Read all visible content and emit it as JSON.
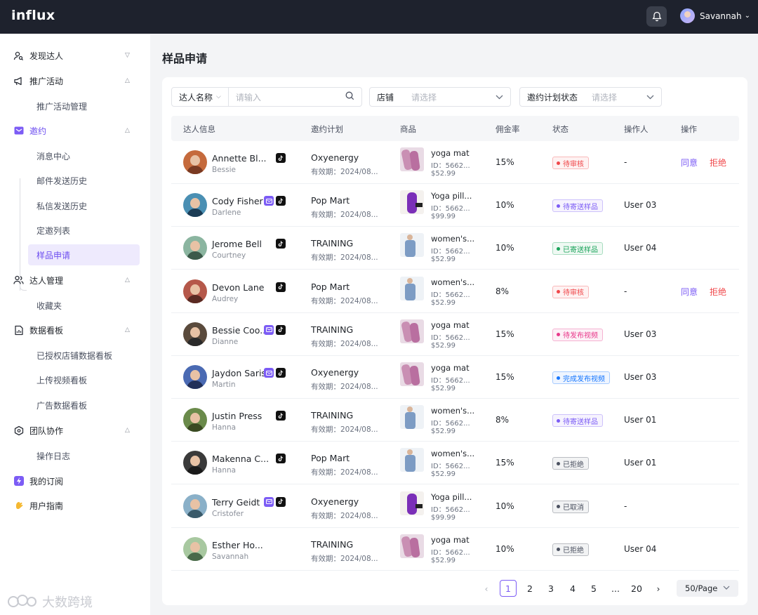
{
  "app": {
    "logo": "influx",
    "user_name": "Savannah"
  },
  "sidebar": {
    "items": [
      {
        "label": "发现达人",
        "icon": "search-user-icon",
        "chevron": "down"
      },
      {
        "label": "推广活动",
        "icon": "megaphone-icon",
        "chevron": "up"
      },
      {
        "label": "推广活动管理"
      },
      {
        "label": "邀约",
        "icon": "mail-icon",
        "chevron": "up"
      },
      {
        "label": "消息中心"
      },
      {
        "label": "邮件发送历史"
      },
      {
        "label": "私信发送历史"
      },
      {
        "label": "定邀列表"
      },
      {
        "label": "样品申请"
      },
      {
        "label": "达人管理",
        "icon": "users-icon",
        "chevron": "up"
      },
      {
        "label": "收藏夹"
      },
      {
        "label": "数据看板",
        "icon": "dashboard-icon",
        "chevron": "up"
      },
      {
        "label": "已授权店铺数据看板"
      },
      {
        "label": "上传视频看板"
      },
      {
        "label": "广告数据看板"
      },
      {
        "label": "团队协作",
        "icon": "team-icon",
        "chevron": "up"
      },
      {
        "label": "操作日志"
      },
      {
        "label": "我的订阅",
        "icon": "lightning-icon"
      },
      {
        "label": "用户指南",
        "icon": "hand-wave-icon"
      }
    ],
    "watermark": "大数跨境"
  },
  "page": {
    "title": "样品申请"
  },
  "filters": {
    "creator_label": "达人名称",
    "creator_placeholder": "请输入",
    "shop_label": "店铺",
    "shop_placeholder": "请选择",
    "plan_status_label": "邀约计划状态",
    "plan_status_placeholder": "请选择"
  },
  "table": {
    "headers": [
      "达人信息",
      "邀约计划",
      "商品",
      "佣金率",
      "状态",
      "操作人",
      "操作"
    ],
    "rows": [
      {
        "name": "Annette Bl...",
        "sub": "Bessie",
        "badges": [
          "tiktok"
        ],
        "plan": "Oxyenergy",
        "valid": "有效期：2024/08...",
        "product": "yoga mat",
        "pid": "ID：5662...",
        "price": "$52.99",
        "rate": "15%",
        "status": "待审核",
        "status_color": "#f0474a",
        "operator": "-",
        "ok": "同意",
        "no": "拒绝"
      },
      {
        "name": "Cody Fisher",
        "sub": "Darlene",
        "badges": [
          "instagram",
          "tiktok"
        ],
        "plan": "Pop Mart",
        "valid": "有效期：2024/08...",
        "product": "Yoga pill...",
        "pid": "ID：5662...",
        "price": "$99.99",
        "rate": "10%",
        "status": "待寄送样品",
        "status_color": "#7c5cf5",
        "operator": "User 03"
      },
      {
        "name": "Jerome Bell",
        "sub": "Courtney",
        "badges": [
          "tiktok"
        ],
        "plan": "TRAINING",
        "valid": "有效期：2024/08...",
        "product": "women's...",
        "pid": "ID：5662...",
        "price": "$52.99",
        "rate": "10%",
        "status": "已寄送样品",
        "status_color": "#1aa35a",
        "operator": "User 04"
      },
      {
        "name": "Devon Lane",
        "sub": "Audrey",
        "badges": [
          "tiktok"
        ],
        "plan": "Pop Mart",
        "valid": "有效期：2024/08...",
        "product": "women's...",
        "pid": "ID：5662...",
        "price": "$52.99",
        "rate": "8%",
        "status": "待审核",
        "status_color": "#f0474a",
        "operator": "-",
        "ok": "同意",
        "no": "拒绝"
      },
      {
        "name": "Bessie Coo...",
        "sub": "Dianne",
        "badges": [
          "instagram",
          "tiktok"
        ],
        "plan": "TRAINING",
        "valid": "有效期：2024/08...",
        "product": "yoga mat",
        "pid": "ID：5662...",
        "price": "$52.99",
        "rate": "15%",
        "status": "待发布视频",
        "status_color": "#e8388a",
        "operator": "User 03"
      },
      {
        "name": "Jaydon Saris",
        "sub": "Martin",
        "badges": [
          "instagram",
          "tiktok"
        ],
        "plan": "Oxyenergy",
        "valid": "有效期：2024/08...",
        "product": "yoga mat",
        "pid": "ID：5662...",
        "price": "$52.99",
        "rate": "15%",
        "status": "完成发布视频",
        "status_color": "#1677ff",
        "operator": "User 03"
      },
      {
        "name": "Justin Press",
        "sub": "Hanna",
        "badges": [
          "tiktok"
        ],
        "plan": "TRAINING",
        "valid": "有效期：2024/08...",
        "product": "women's...",
        "pid": "ID：5662...",
        "price": "$52.99",
        "rate": "8%",
        "status": "待寄送样品",
        "status_color": "#7c5cf5",
        "operator": "User 01"
      },
      {
        "name": "Makenna C...",
        "sub": "Hanna",
        "badges": [
          "tiktok"
        ],
        "plan": "Pop Mart",
        "valid": "有效期：2024/08...",
        "product": "women's...",
        "pid": "ID：5662...",
        "price": "$52.99",
        "rate": "15%",
        "status": "已拒绝",
        "status_color": "#4b5160",
        "operator": "User 01"
      },
      {
        "name": "Terry Geidt",
        "sub": "Cristofer",
        "badges": [
          "instagram",
          "tiktok"
        ],
        "plan": "Oxyenergy",
        "valid": "有效期：2024/08...",
        "product": "Yoga pill...",
        "pid": "ID：5662...",
        "price": "$99.99",
        "rate": "10%",
        "status": "已取消",
        "status_color": "#4b5160",
        "operator": "-"
      },
      {
        "name": "Esther Ho...",
        "sub": "Savannah",
        "badges": [],
        "plan": "TRAINING",
        "valid": "有效期：2024/08...",
        "product": "yoga mat",
        "pid": "ID：5662...",
        "price": "$52.99",
        "rate": "10%",
        "status": "已拒绝",
        "status_color": "#4b5160",
        "operator": "User 04"
      }
    ]
  },
  "pagination": {
    "pages": [
      "1",
      "2",
      "3",
      "4",
      "5",
      "...",
      "20"
    ],
    "current": "1",
    "page_size": "50/Page"
  },
  "colors": {
    "accent": "#7c5cf5",
    "topbar": "#1e222d"
  }
}
